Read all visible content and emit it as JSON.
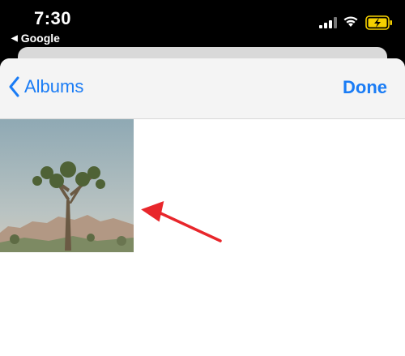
{
  "status_bar": {
    "time": "7:30",
    "back_app_label": "Google",
    "back_app_icon": "left-triangle-icon",
    "battery_icon": "battery-charging-icon",
    "wifi_icon": "wifi-icon",
    "signal_icon": "cellular-signal-icon"
  },
  "navbar": {
    "back_label": "Albums",
    "done_label": "Done"
  },
  "grid": {
    "photos": [
      {
        "selected": true,
        "alt": "joshua-tree-photo"
      }
    ]
  },
  "colors": {
    "accent": "#1a7cf5",
    "annotation_arrow": "#e8262b",
    "battery_fill": "#f5d000"
  }
}
